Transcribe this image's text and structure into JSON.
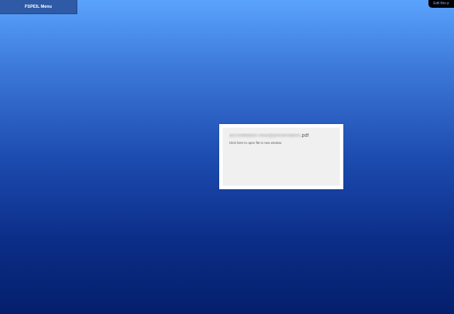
{
  "menu": {
    "label": "FSPEIL Menu"
  },
  "edit_tab": {
    "label": "Edit this p"
  },
  "file_card": {
    "name": "accreditation-new@presentation",
    "extension": ".pdf",
    "hint": "Click here to open file in new window"
  },
  "colors": {
    "background_top": "#5aa3fd",
    "background_bottom": "#041e6b",
    "menu_bg": "#2e5aa6",
    "card_bg": "#ffffff",
    "card_inner_bg": "#f0f0f0"
  }
}
